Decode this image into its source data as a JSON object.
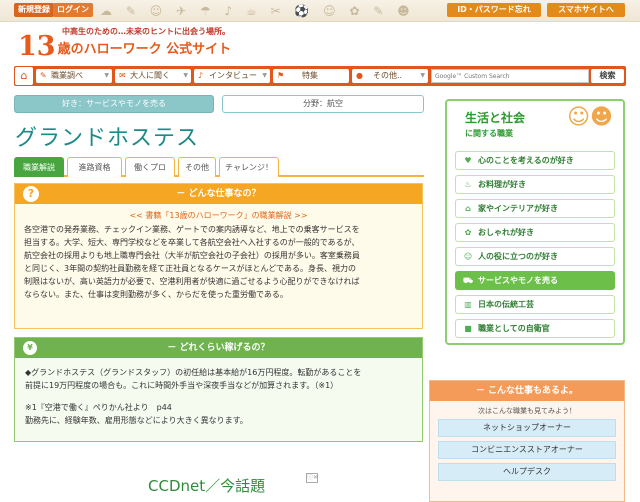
{
  "top": {
    "signup": "新規登録",
    "login": "ログイン",
    "id_password": "ID・パスワード忘れ",
    "smartphone": "スマホサイトへ"
  },
  "header": {
    "tagline": "中高生のための…未来のヒントに出会う場所。",
    "logo_number": "13",
    "logo_text": "歳のハローワーク 公式サイト"
  },
  "nav": {
    "items": [
      "職業調べ",
      "大人に聞く",
      "インタビュー",
      "特集",
      "その他.."
    ],
    "search_placeholder": "Google™ Custom Search",
    "search_button": "検索"
  },
  "category": {
    "left": "好き：サービスやモノを売る",
    "right": "分野：航空"
  },
  "page_title": "グランドホステス",
  "tabs": [
    "職業解説",
    "進路資格",
    "働くプロ",
    "その他",
    "チャレンジ！"
  ],
  "section1": {
    "heading": "－ どんな仕事なの？",
    "source": "<< 書籍「13歳のハローワーク」の職業解説 >>",
    "lines": [
      "各空港での発券業務、チェックイン業務、ゲートでの案内誘導など、地上での乗客サービスを",
      "担当する。大学、短大、専門学校などを卒業して各航空会社へ入社するのが一般的であるが、",
      "航空会社の採用よりも地上職専門会社（大半が航空会社の子会社）の採用が多い。客室乗務員",
      "と同じく、3年間の契約社員勤務を経て正社員となるケースがほとんどである。身長、視力の",
      "制限はないが、高い英語力が必要で、空港利用者が快適に過ごせるよう心配りができなければ",
      "ならない。また、仕事は変則勤務が多く、からだを使った重労働である。"
    ]
  },
  "section2": {
    "heading": "－ どれくらい稼げるの？",
    "lines": [
      "◆グランドホステス（グランドスタッフ）の初任給は基本給が16万円程度。転勤があることを",
      "前提に19万円程度の場合も。これに時間外手当や深夜手当などが加算されます。（※1）"
    ],
    "notes": [
      "※1『空港で働く』ぺりかん社より　p44",
      "勤務先に、経験年数、雇用形態などにより大きく異なります。"
    ]
  },
  "ad": {
    "text": "CCDnet／今話題"
  },
  "sidebar": {
    "title": "生活と社会",
    "subtitle": "に関する職業",
    "items": [
      "心のことを考えるのが好き",
      "お料理が好き",
      "家やインテリアが好き",
      "おしゃれが好き",
      "人の役に立つのが好き",
      "サービスやモノを売る",
      "日本の伝統工芸",
      "職業としての自衛官"
    ]
  },
  "sidebar2": {
    "heading": "－ こんな仕事もあるよ。",
    "sub": "次はこんな職業も見てみよう！",
    "links": [
      "ネットショップオーナー",
      "コンビニエンスストアオーナー",
      "ヘルプデスク"
    ]
  },
  "colors": {
    "brand_orange": "#e1571a",
    "teal_title": "#1c8a86",
    "green_active": "#6cc04a",
    "section1_head": "#f5a623",
    "section2_head": "#6fb24f"
  }
}
